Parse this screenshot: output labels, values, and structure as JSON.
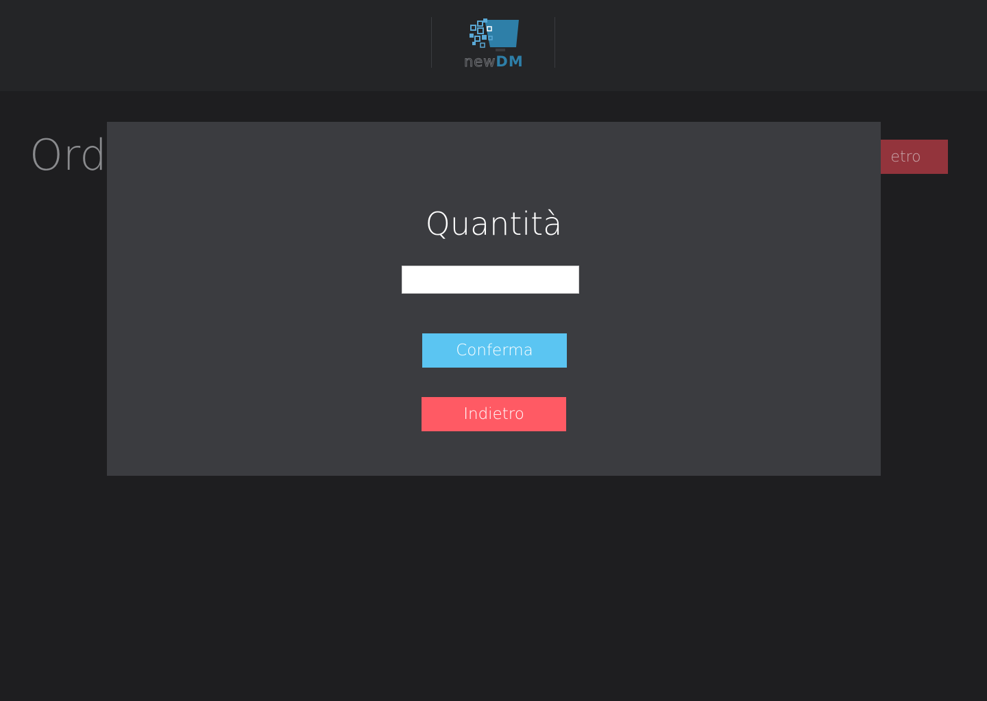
{
  "header": {
    "logo_text_light": "new",
    "logo_text_bold": "DM"
  },
  "background": {
    "title": "Ordi",
    "back_button_label": "etro"
  },
  "modal": {
    "title": "Quantità",
    "quantity_input": {
      "value": "",
      "placeholder": ""
    },
    "confirm_label": "Conferma",
    "back_label": "Indietro"
  },
  "colors": {
    "confirm": "#5bc5f2",
    "back": "#ff5a64",
    "brand": "#2e7fa8"
  }
}
